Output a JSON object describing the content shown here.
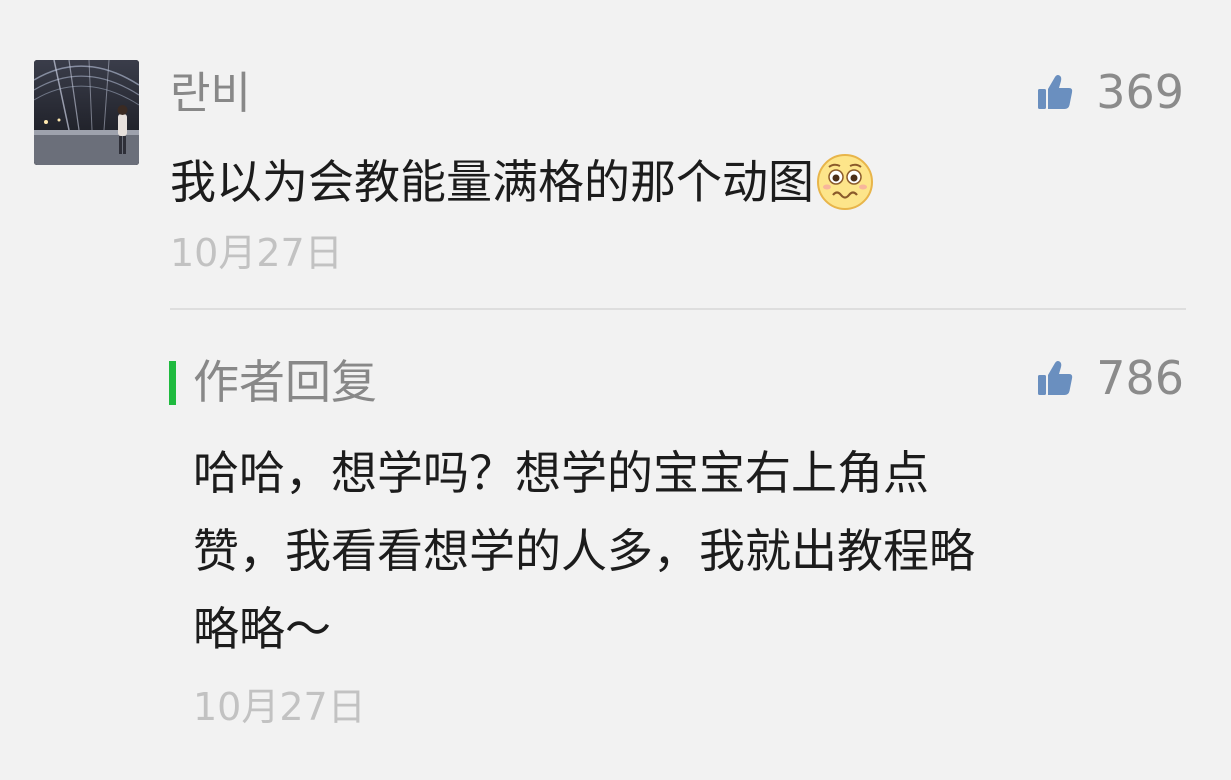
{
  "comment": {
    "username": "란비",
    "likes": "369",
    "text": "我以为会教能量满格的那个动图",
    "emoji": "worried-face-emoji",
    "date": "10月27日"
  },
  "reply": {
    "label": "作者回复",
    "likes": "786",
    "lines": [
      "哈哈，想学吗？想学的宝宝右上角点",
      "赞，我看看想学的人多，我就出教程略",
      "略略～"
    ],
    "date": "10月27日"
  },
  "colors": {
    "background": "#f2f2f2",
    "reply_accent": "#1fba3f",
    "like_icon": "#6a8fbf"
  }
}
